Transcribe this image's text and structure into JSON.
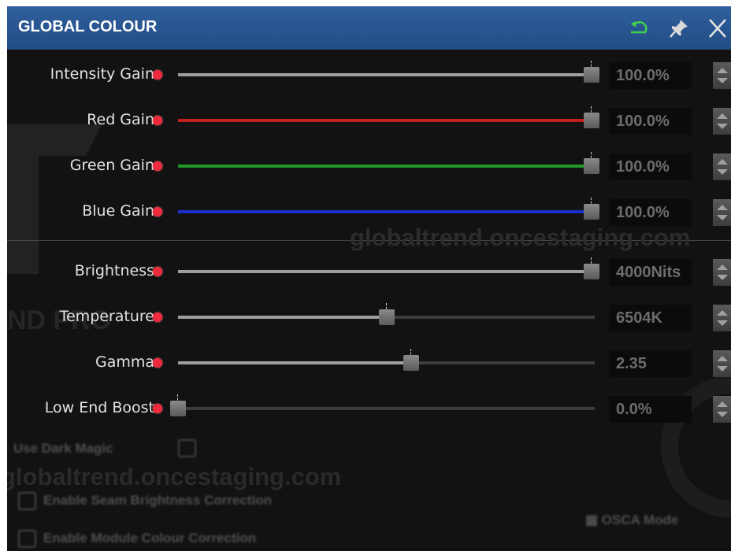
{
  "window": {
    "title": "GLOBAL COLOUR",
    "icons": {
      "reset": "reset-icon",
      "pin": "pin-icon",
      "close": "close-icon"
    },
    "accent": "#2a5a97",
    "indicator_color": "#ee2a3c"
  },
  "sliders_group1": [
    {
      "label": "Intensity Gain",
      "value": "100.0%",
      "level": 1.0,
      "fill_color": "#9e9e9e"
    },
    {
      "label": "Red Gain",
      "value": "100.0%",
      "level": 1.0,
      "fill_color": "#c41e1e"
    },
    {
      "label": "Green Gain",
      "value": "100.0%",
      "level": 1.0,
      "fill_color": "#1f9a2a"
    },
    {
      "label": "Blue Gain",
      "value": "100.0%",
      "level": 1.0,
      "fill_color": "#1a2fc9"
    }
  ],
  "sliders_group2": [
    {
      "label": "Brightness",
      "value": "4000Nits",
      "level": 1.0,
      "fill_color": "#9e9e9e"
    },
    {
      "label": "Temperature",
      "value": "6504K",
      "level": 0.5,
      "fill_color": "#9e9e9e"
    },
    {
      "label": "Gamma",
      "value": "2.35",
      "level": 0.56,
      "fill_color": "#9e9e9e"
    },
    {
      "label": "Low End Boost",
      "value": "0.0%",
      "level": 0.0,
      "fill_color": "#9e9e9e"
    }
  ],
  "options": {
    "use_dark_magic": "Use Dark Magic",
    "enable_seam": "Enable Seam Brightness Correction",
    "enable_module": "Enable Module Colour Correction",
    "osca_mode": "OSCA Mode"
  },
  "watermark": {
    "text1": "globaltrend.oncestaging.com",
    "text2": "globaltrend.oncestaging.com",
    "text3": "ND PRO"
  }
}
